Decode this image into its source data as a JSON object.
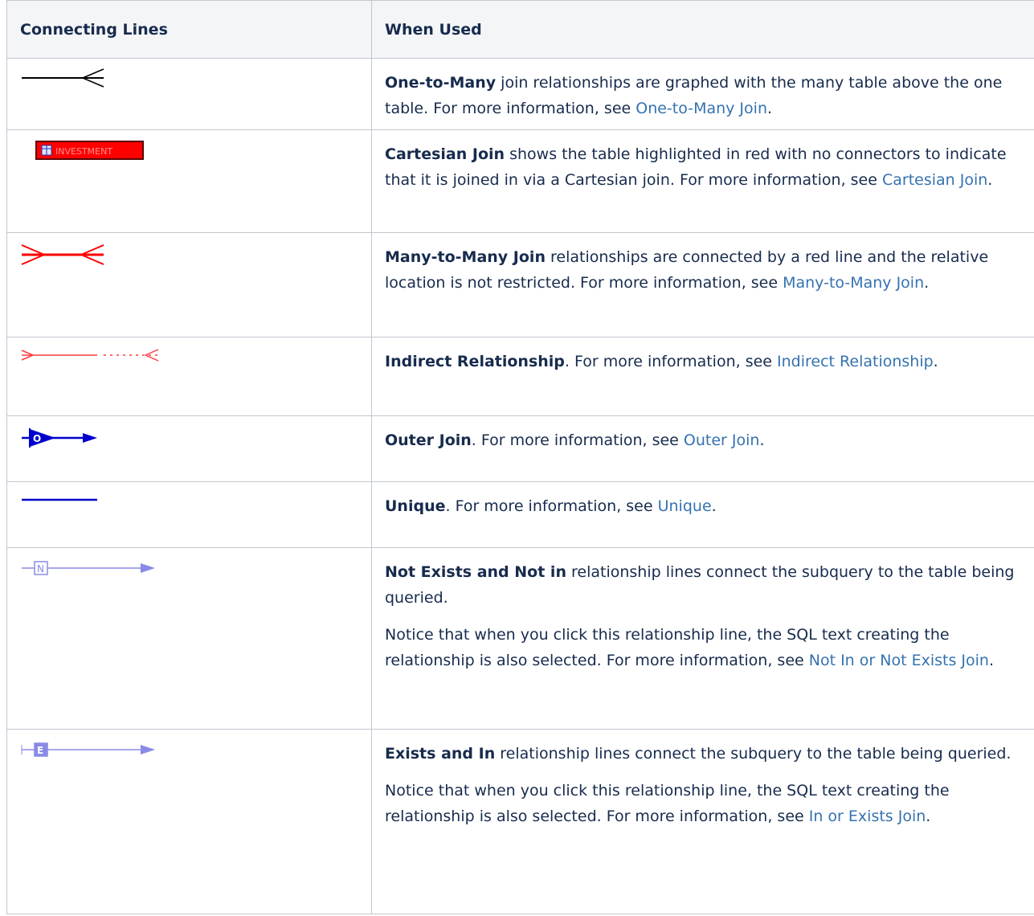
{
  "headers": {
    "col1": "Connecting Lines",
    "col2": "When Used"
  },
  "rows": [
    {
      "icon": "one-to-many-line-icon",
      "bold": "One-to-Many",
      "text": " join relationships are graphed with the many table above the one table. For more information, see ",
      "link": "One-to-Many Join",
      "end": "."
    },
    {
      "icon": "cartesian-table-icon",
      "icon_label": "INVESTMENT",
      "bold": "Cartesian Join",
      "text": " shows the table highlighted in red with no connectors to indicate that it is joined in via a Cartesian join. For more information, see ",
      "link": "Cartesian Join",
      "end": "."
    },
    {
      "icon": "many-to-many-line-icon",
      "bold": "Many-to-Many Join",
      "text": " relationships are connected by a red line and the relative location is not restricted. For more information, see ",
      "link": "Many-to-Many Join",
      "end": "."
    },
    {
      "icon": "indirect-relationship-line-icon",
      "bold": "Indirect Relationship",
      "text": ". For more information, see ",
      "link": "Indirect Relationship",
      "end": "."
    },
    {
      "icon": "outer-join-line-icon",
      "icon_label": "O",
      "bold": "Outer Join",
      "text": ". For more information, see ",
      "link": "Outer Join",
      "end": "."
    },
    {
      "icon": "unique-line-icon",
      "bold": "Unique",
      "text": ". For more information, see ",
      "link": "Unique",
      "end": "."
    },
    {
      "icon": "not-exists-line-icon",
      "icon_label": "N",
      "bold": "Not Exists and Not in",
      "text": " relationship lines connect the subquery to the table being queried.",
      "note": "Notice that when you click this relationship line, the SQL text creating the relationship is also selected. For more information, see ",
      "link": "Not In or Not Exists Join",
      "end": "."
    },
    {
      "icon": "exists-line-icon",
      "icon_label": "E",
      "bold": "Exists and In",
      "text": " relationship lines connect the subquery to the table being queried.",
      "note": "Notice that when you click this relationship line, the SQL text creating the relationship is also selected. For more information, see ",
      "link": "In or Exists Join",
      "end": "."
    }
  ],
  "colors": {
    "link": "#3572b0",
    "header_bg": "#f4f5f7",
    "border": "#c1c7d0",
    "red": "#ff0000",
    "blue": "#0000cc",
    "light_blue": "#8a8ae6"
  }
}
